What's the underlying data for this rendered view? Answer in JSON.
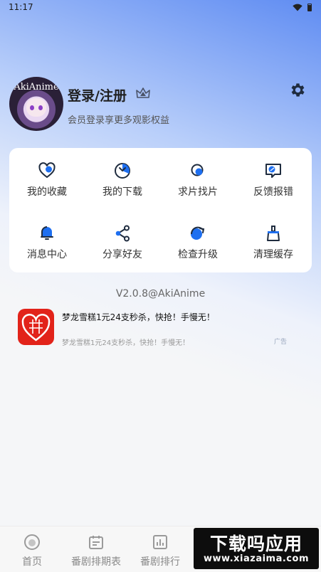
{
  "status_bar": {
    "time": "11:17"
  },
  "profile": {
    "avatar_text": "AkiAnime",
    "login_title": "登录/注册",
    "login_subtitle": "会员登录享更多观影权益"
  },
  "menu": {
    "items": [
      {
        "label": "我的收藏",
        "icon": "heart-icon"
      },
      {
        "label": "我的下载",
        "icon": "download-icon"
      },
      {
        "label": "求片找片",
        "icon": "search-icon"
      },
      {
        "label": "反馈报错",
        "icon": "feedback-icon"
      },
      {
        "label": "消息中心",
        "icon": "bell-icon"
      },
      {
        "label": "分享好友",
        "icon": "share-icon"
      },
      {
        "label": "检查升级",
        "icon": "upgrade-icon"
      },
      {
        "label": "清理缓存",
        "icon": "broom-icon"
      }
    ]
  },
  "version": "V2.0.8@AkiAnime",
  "ad": {
    "title": "梦龙雪糕1元24支秒杀，快抢！手慢无！",
    "description": "梦龙雪糕1元24支秒杀，快抢！手慢无！",
    "tag": "广告"
  },
  "tabbar": {
    "tabs": [
      {
        "label": "首页",
        "icon": "home-icon"
      },
      {
        "label": "番剧排期表",
        "icon": "calendar-icon"
      },
      {
        "label": "番剧排行",
        "icon": "ranking-icon"
      }
    ]
  },
  "watermark": {
    "main": "下载吗应用",
    "url": "www.xiazaima.com"
  },
  "colors": {
    "accent": "#1e6ff0",
    "ad_red": "#e2231a"
  }
}
